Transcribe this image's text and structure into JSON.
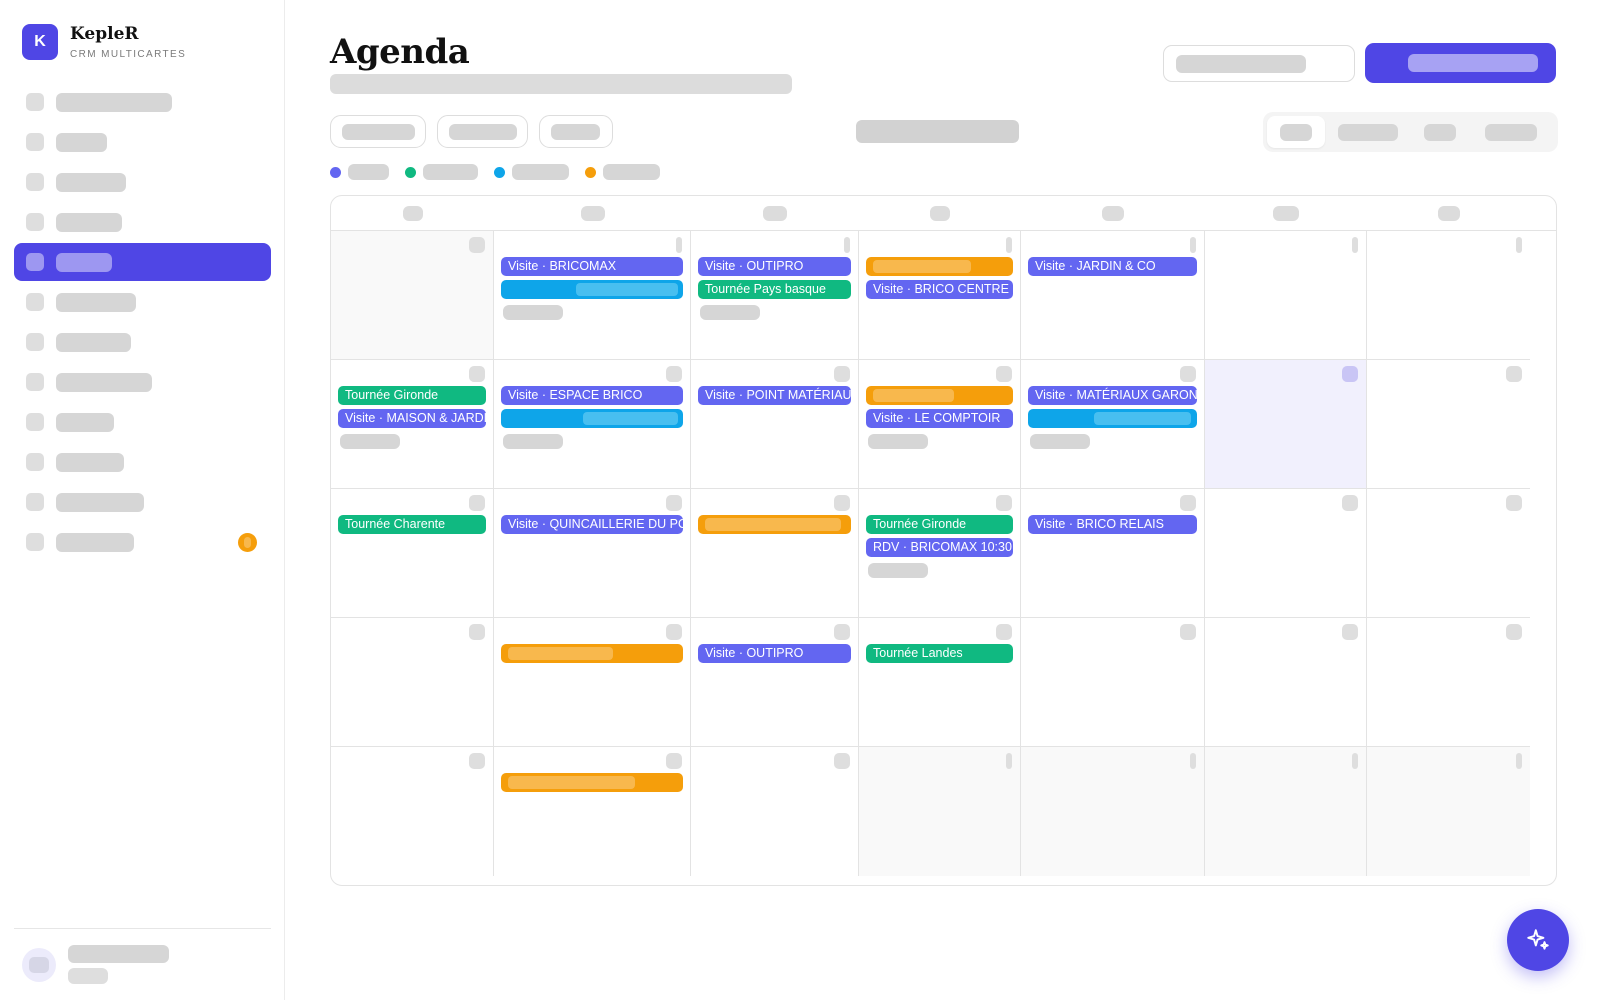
{
  "app": {
    "logo_letter": "K",
    "name": "KepleR",
    "subtitle": "CRM MULTICARTES"
  },
  "colors": {
    "accent": "#4f46e5",
    "visit": "#6366f1",
    "tour": "#10b981",
    "call": "#0ea5e9",
    "task": "#f59e0b"
  },
  "sidebar": {
    "active_index": 4,
    "badge_index": 11
  },
  "page": {
    "title": "Agenda"
  },
  "legend": [
    {
      "color": "#6366f1"
    },
    {
      "color": "#10b981"
    },
    {
      "color": "#0ea5e9"
    },
    {
      "color": "#f59e0b"
    }
  ],
  "calendar": {
    "events": {
      "r0c1": [
        "Visite · BRICOMAX"
      ],
      "r0c2": [
        "Visite · OUTIPRO",
        "Tournée Pays basque"
      ],
      "r0c3": [
        "Visite · BRICO CENTRE"
      ],
      "r0c4": [
        "Visite · JARDIN & CO"
      ],
      "r1c0": [
        "Tournée Gironde",
        "Visite · MAISON & JARDIN"
      ],
      "r1c1": [
        "Visite · ESPACE BRICO"
      ],
      "r1c2": [
        "Visite · POINT MATÉRIAUX"
      ],
      "r1c3": [
        "Visite · LE COMPTOIR"
      ],
      "r1c4": [
        "Visite · MATÉRIAUX GARONNE"
      ],
      "r2c0": [
        "Tournée Charente"
      ],
      "r2c1": [
        "Visite · QUINCAILLERIE DU PORT"
      ],
      "r2c3": [
        "Tournée Gironde",
        "RDV · BRICOMAX 10:30"
      ],
      "r2c4": [
        "Visite · BRICO RELAIS"
      ],
      "r3c2": [
        "Visite · OUTIPRO"
      ],
      "r3c3": [
        "Tournée Landes"
      ]
    }
  },
  "fab": {
    "icon": "sparkles-icon"
  }
}
